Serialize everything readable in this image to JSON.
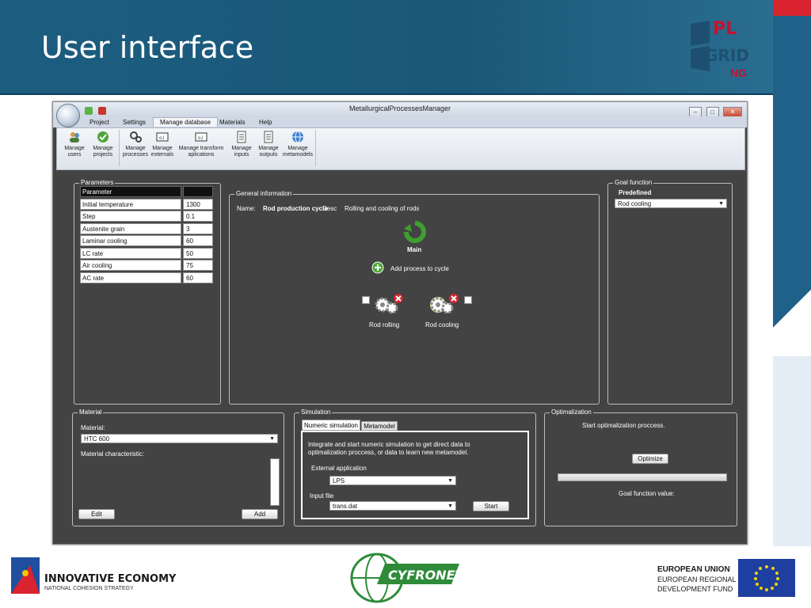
{
  "slide": {
    "title": "User interface",
    "logo_text_pl": "PL",
    "logo_text_grid": "GRID",
    "logo_text_ng": "NG"
  },
  "window": {
    "title": "MetallurgicalProcessesManager",
    "controls": {
      "minimize": "–",
      "maximize": "□",
      "close": "✕"
    }
  },
  "ribbon_tabs": [
    {
      "label": "Project"
    },
    {
      "label": "Settings"
    },
    {
      "label": "Manage database"
    },
    {
      "label": "Materials"
    },
    {
      "label": "Help"
    }
  ],
  "ribbon_buttons": [
    {
      "label": "Manage users",
      "icon": "users-icon"
    },
    {
      "label": "Manage projects",
      "icon": "projects-icon"
    },
    {
      "label": "Manage processes",
      "icon": "gears-icon"
    },
    {
      "label": "Manage externals",
      "icon": "externals-icon"
    },
    {
      "label": "Manage transform aplications",
      "icon": "transform-icon"
    },
    {
      "label": "Manage inputs",
      "icon": "document-icon"
    },
    {
      "label": "Manage outputs",
      "icon": "document-icon"
    },
    {
      "label": "Manage metamodels",
      "icon": "globe-icon"
    }
  ],
  "parameters": {
    "title": "Parameters",
    "header": {
      "name": "Parameter",
      "value": ""
    },
    "rows": [
      {
        "name": "Initial temperature",
        "value": "1300"
      },
      {
        "name": "Step",
        "value": "0.1"
      },
      {
        "name": "Austenite grain",
        "value": "3"
      },
      {
        "name": "Laminar cooling",
        "value": "60"
      },
      {
        "name": "LC rate",
        "value": "50"
      },
      {
        "name": "Air cooling",
        "value": "75"
      },
      {
        "name": "AC rate",
        "value": "60"
      }
    ]
  },
  "general": {
    "title": "General information",
    "name_label": "Name:",
    "name_value": "Rod production cycle",
    "desc_label": "Desc",
    "desc_value": "Rolling and cooling of rods",
    "main_label": "Main",
    "add_label": "Add process to cycle",
    "processes": [
      {
        "label": "Rod rolling"
      },
      {
        "label": "Rod cooling"
      }
    ]
  },
  "goal": {
    "title": "Goal function",
    "predefined_label": "Predefined",
    "selected": "Rod cooling"
  },
  "material": {
    "title": "Material",
    "material_label": "Material:",
    "selected": "HTC 600",
    "characteristic_label": "Material characteristic:",
    "edit_label": "Edit",
    "add_label": "Add"
  },
  "simulation": {
    "title": "Simulation",
    "tabs": [
      {
        "label": "Numeric simulation"
      },
      {
        "label": "Metamodel"
      }
    ],
    "description": "Integrate and start numeric simulation to get direct data to optimalization proccess, or data to learn new metamodel.",
    "external_label": "External application",
    "external_value": "LPS",
    "input_label": "Input file",
    "input_value": "trans.dat",
    "start_label": "Start"
  },
  "optimalization": {
    "title": "Optimalization",
    "start_text": "Start optimalization proccess.",
    "button_label": "Optimize",
    "progress": 0,
    "goal_value_label": "Goal function value:"
  },
  "footer": {
    "ie_title": "INNOVATIVE ECONOMY",
    "ie_subtitle": "NATIONAL COHESION STRATEGY",
    "cyfronet": "CYFRONET",
    "eu_line1": "EUROPEAN UNION",
    "eu_line2": "EUROPEAN REGIONAL",
    "eu_line3": "DEVELOPMENT FUND"
  },
  "colors": {
    "header_blue": "#1c5d80",
    "app_bg": "#434343",
    "accent_red": "#d9232e",
    "process_green": "#3f9e2f"
  }
}
